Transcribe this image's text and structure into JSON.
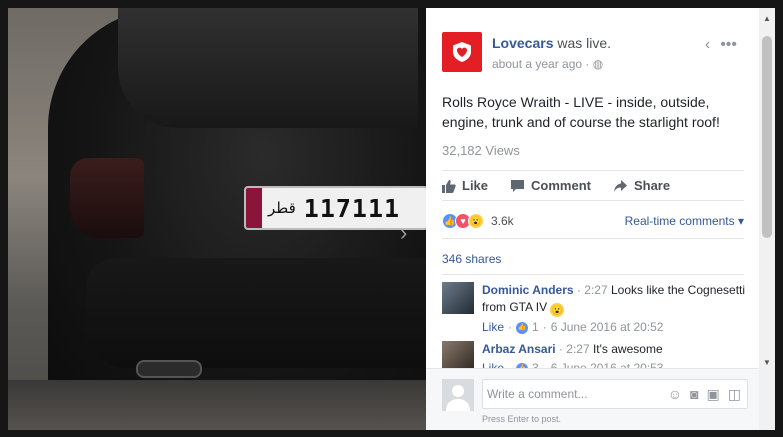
{
  "post": {
    "page_name": "Lovecars",
    "status": "was live.",
    "timestamp": "about a year ago",
    "privacy_icon": "globe-icon",
    "text": "Rolls Royce Wraith - LIVE - inside, outside, engine, trunk and of course the starlight roof!",
    "views": "32,182 Views",
    "brand_color": "#e41e25"
  },
  "video": {
    "plate_country": "قطر",
    "plate_number": "117111"
  },
  "actions": {
    "like": "Like",
    "comment": "Comment",
    "share": "Share"
  },
  "reactions": {
    "icons": [
      "like-icon",
      "love-icon",
      "wow-icon"
    ],
    "count": "3.6k",
    "realtime": "Real-time comments"
  },
  "shares": "346 shares",
  "comments": [
    {
      "name": "Dominic Anders",
      "time": "2:27",
      "text": "Looks like the Cognesetti from GTA IV",
      "like": "Like",
      "likes": "1",
      "date": "6 June 2016 at 20:52"
    },
    {
      "name": "Arbaz Ansari",
      "time": "2:27",
      "text": "It's awesome",
      "like": "Like",
      "likes": "3",
      "date": "6 June 2016 at 20:53"
    }
  ],
  "compose": {
    "placeholder": "Write a comment...",
    "hint": "Press Enter to post.",
    "tools": [
      "emoji-icon",
      "camera-icon",
      "gif-icon",
      "sticker-icon"
    ]
  }
}
